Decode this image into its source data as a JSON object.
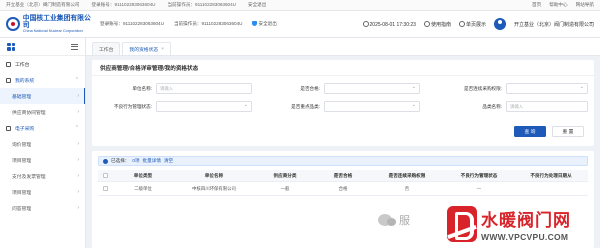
{
  "topstrip": {
    "company": "开立基业（北京）阀门制造有限公司",
    "login_account": "登录账号：911102283063604U",
    "current_operator": "当前操作员：911102283063604U",
    "security_exit": "安全退出",
    "links": [
      "首页",
      "帮助中心",
      "网站导航"
    ]
  },
  "header": {
    "logo_cn": "中国核工业集团有限公司",
    "logo_en": "China National Nuclear Corporation",
    "info_1": "登录账号：911102283063604U",
    "info_2": "当前操作员：911102283063604U",
    "security": "安全退出",
    "datetime": "2025-08-01 17:30:23",
    "guide": "使用指南",
    "single_sign": "单页展示",
    "user_company": "开立基业（北京）阀门制造有限公司"
  },
  "sidebar": {
    "items": [
      {
        "label": "工作台",
        "level": "top"
      },
      {
        "label": "我的系统",
        "level": "group"
      },
      {
        "label": "基础管理",
        "level": "sub",
        "active": true
      },
      {
        "label": "供应商协同管理",
        "level": "sub"
      },
      {
        "label": "电子采购",
        "level": "group"
      },
      {
        "label": "询价管理",
        "level": "sub"
      },
      {
        "label": "项目管理",
        "level": "sub"
      },
      {
        "label": "支付及发票管理",
        "level": "sub"
      },
      {
        "label": "项目管理",
        "level": "sub"
      },
      {
        "label": "问答管理",
        "level": "sub"
      }
    ]
  },
  "tabs": [
    {
      "label": "工作台"
    },
    {
      "label": "我的资格状态",
      "active": true,
      "closable": "×"
    }
  ],
  "breadcrumb": "供应商管理/合格详审管理/我的资格状态",
  "filters": {
    "unit_name_label": "单位名称:",
    "unit_name_placeholder": "请输入",
    "qualified_label": "是否合格:",
    "connect_label": "是否连续采购权限:",
    "bad_behavior_label": "不良行为管理状态:",
    "is_important_label": "是否重点品类:",
    "category_name_label": "品类名称:",
    "category_name_placeholder": "请输入",
    "search": "查 询",
    "reset": "重 置"
  },
  "selection": {
    "text": "已选择：",
    "count": "0项",
    "batch": "批量详情",
    "clear": "清空"
  },
  "table": {
    "columns": [
      "单位类型",
      "单位名称",
      "供应商分类",
      "是否合格",
      "是否连续采购权限",
      "不良行为管理状态",
      "不良行为处理日期从"
    ],
    "rows": [
      [
        "二级单位",
        "中核四川环保有限公司",
        "一般",
        "合格",
        "否",
        "—",
        ""
      ]
    ]
  },
  "watermark": {
    "label": "服",
    "brand_cn": "水暖阀门网",
    "brand_en": "WWW.VPCVPU.COM"
  }
}
